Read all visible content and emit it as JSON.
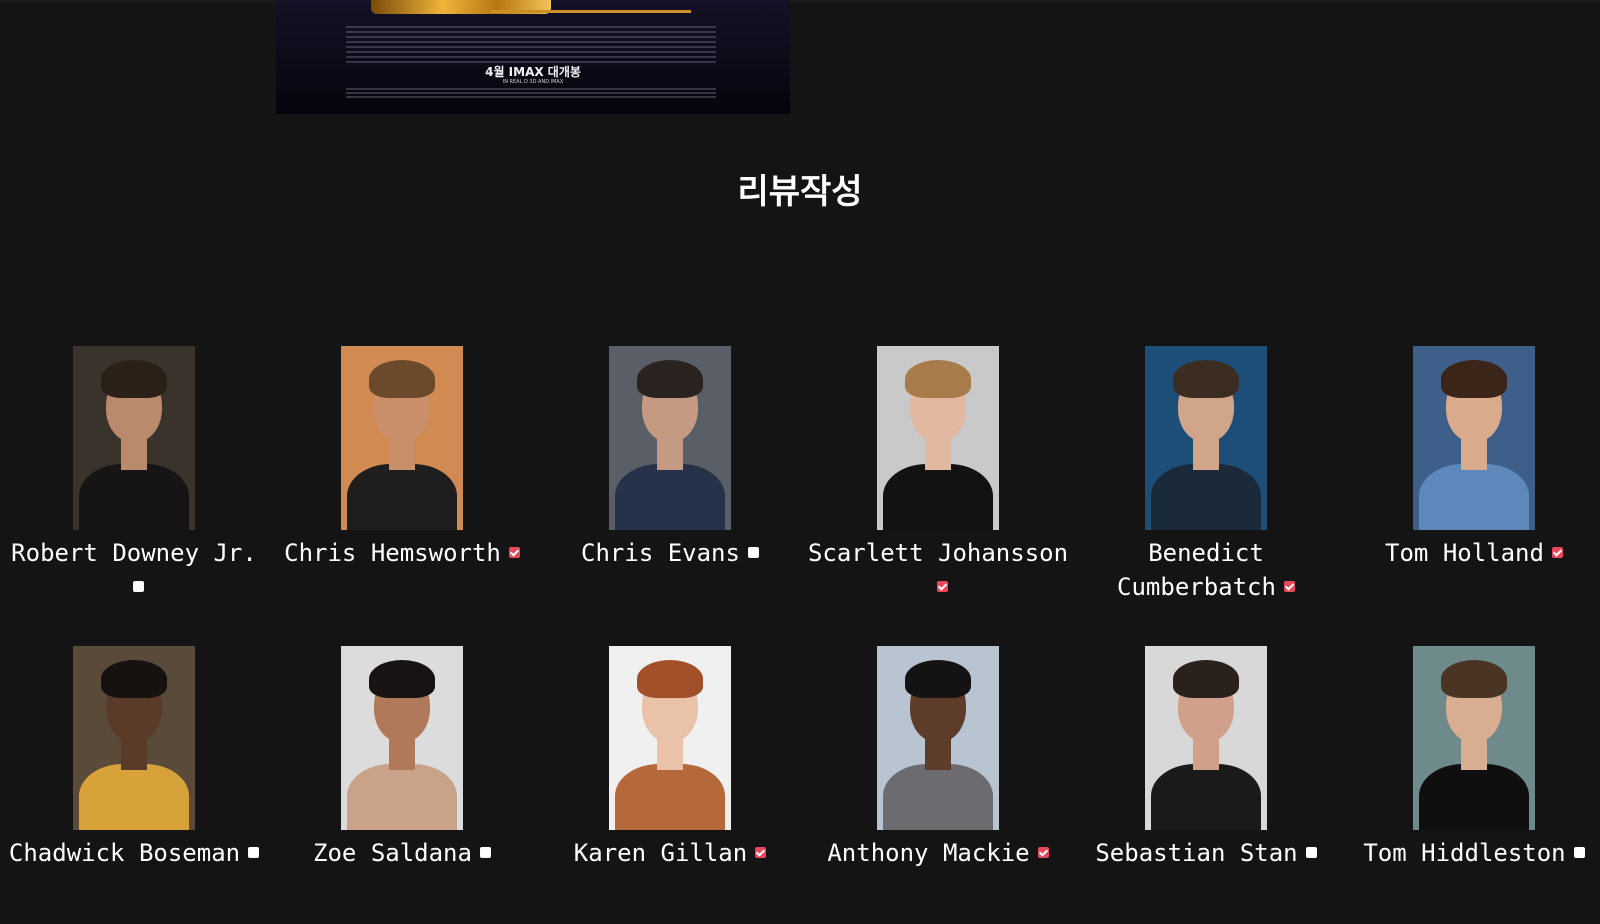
{
  "poster": {
    "release_text": "4월 IMAX 대개봉",
    "release_sub": "IN REAL D 3D AND IMAX"
  },
  "section": {
    "title": "리뷰작성"
  },
  "cast": [
    {
      "name": "Robert Downey Jr.",
      "checked": false,
      "photo": {
        "bg": "#3a332c",
        "skin": "#b98a6c",
        "hair": "#2a2018",
        "clothes": "#161414"
      }
    },
    {
      "name": "Chris Hemsworth",
      "checked": true,
      "photo": {
        "bg": "#d08a52",
        "skin": "#c98e6a",
        "hair": "#6a4a2a",
        "clothes": "#1e1e1e"
      }
    },
    {
      "name": "Chris Evans",
      "checked": false,
      "photo": {
        "bg": "#5a5e66",
        "skin": "#c49a82",
        "hair": "#2a2320",
        "clothes": "#26324a"
      }
    },
    {
      "name": "Scarlett Johansson",
      "checked": true,
      "photo": {
        "bg": "#c9c9c9",
        "skin": "#e2b9a0",
        "hair": "#a77c4a",
        "clothes": "#121212"
      }
    },
    {
      "name": "Benedict Cumberbatch",
      "checked": true,
      "photo": {
        "bg": "#1d4e78",
        "skin": "#d0a58a",
        "hair": "#3b2d22",
        "clothes": "#1b2a3a"
      }
    },
    {
      "name": "Tom Holland",
      "checked": true,
      "photo": {
        "bg": "#3d5f8a",
        "skin": "#d9aa8c",
        "hair": "#3a2518",
        "clothes": "#5d88bb"
      }
    },
    {
      "name": "Chadwick Boseman",
      "checked": false,
      "photo": {
        "bg": "#5a4a3a",
        "skin": "#5a3a28",
        "hair": "#151210",
        "clothes": "#d8a23a"
      }
    },
    {
      "name": "Zoe Saldana",
      "checked": false,
      "photo": {
        "bg": "#dcdcdc",
        "skin": "#b07a5a",
        "hair": "#161312",
        "clothes": "#c9a28a"
      }
    },
    {
      "name": "Karen Gillan",
      "checked": true,
      "photo": {
        "bg": "#f0f0f0",
        "skin": "#eac2aa",
        "hair": "#a2502a",
        "clothes": "#b5683a"
      }
    },
    {
      "name": "Anthony Mackie",
      "checked": true,
      "photo": {
        "bg": "#b9c4d2",
        "skin": "#5e3c2a",
        "hair": "#141212",
        "clothes": "#6b6b70"
      }
    },
    {
      "name": "Sebastian Stan",
      "checked": false,
      "photo": {
        "bg": "#d8d8d8",
        "skin": "#d0a08a",
        "hair": "#2a201c",
        "clothes": "#1a1a1a"
      }
    },
    {
      "name": "Tom Hiddleston",
      "checked": false,
      "photo": {
        "bg": "#6e8a8a",
        "skin": "#d9ad92",
        "hair": "#4a3424",
        "clothes": "#0f0f10"
      }
    }
  ]
}
